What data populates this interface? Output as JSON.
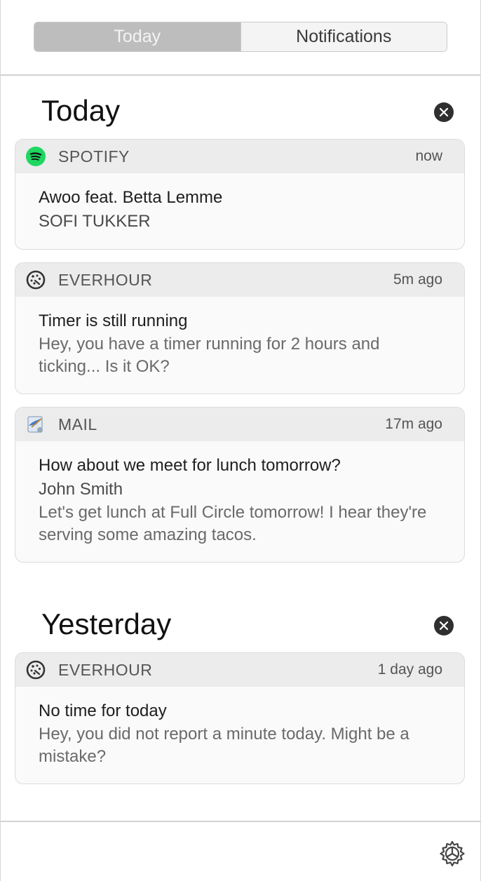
{
  "tabs": {
    "today": "Today",
    "notifications": "Notifications"
  },
  "sections": {
    "today": {
      "title": "Today",
      "cards": [
        {
          "app": "SPOTIFY",
          "time": "now",
          "title": "Awoo feat. Betta Lemme",
          "subtitle": "SOFI TUKKER"
        },
        {
          "app": "EVERHOUR",
          "time": "5m ago",
          "title": "Timer is still running",
          "text": "Hey, you have a timer running for 2 hours and ticking... Is it OK?"
        },
        {
          "app": "MAIL",
          "time": "17m ago",
          "title": "How about we meet for lunch tomorrow?",
          "subtitle": "John Smith",
          "text": "Let's get lunch at Full Circle tomorrow! I hear they're serving some amazing tacos."
        }
      ]
    },
    "yesterday": {
      "title": "Yesterday",
      "cards": [
        {
          "app": "EVERHOUR",
          "time": "1 day ago",
          "title": "No time for today",
          "text": "Hey, you did not report a minute today. Might be a mistake?"
        }
      ]
    }
  },
  "icons": {
    "spotify": "spotify-icon",
    "everhour": "everhour-icon",
    "mail": "mail-icon",
    "clear": "close-icon",
    "settings": "gear-icon"
  },
  "colors": {
    "spotify_green": "#1ed760",
    "active_tab": "#bdbdbd",
    "card_header": "#ececec"
  }
}
